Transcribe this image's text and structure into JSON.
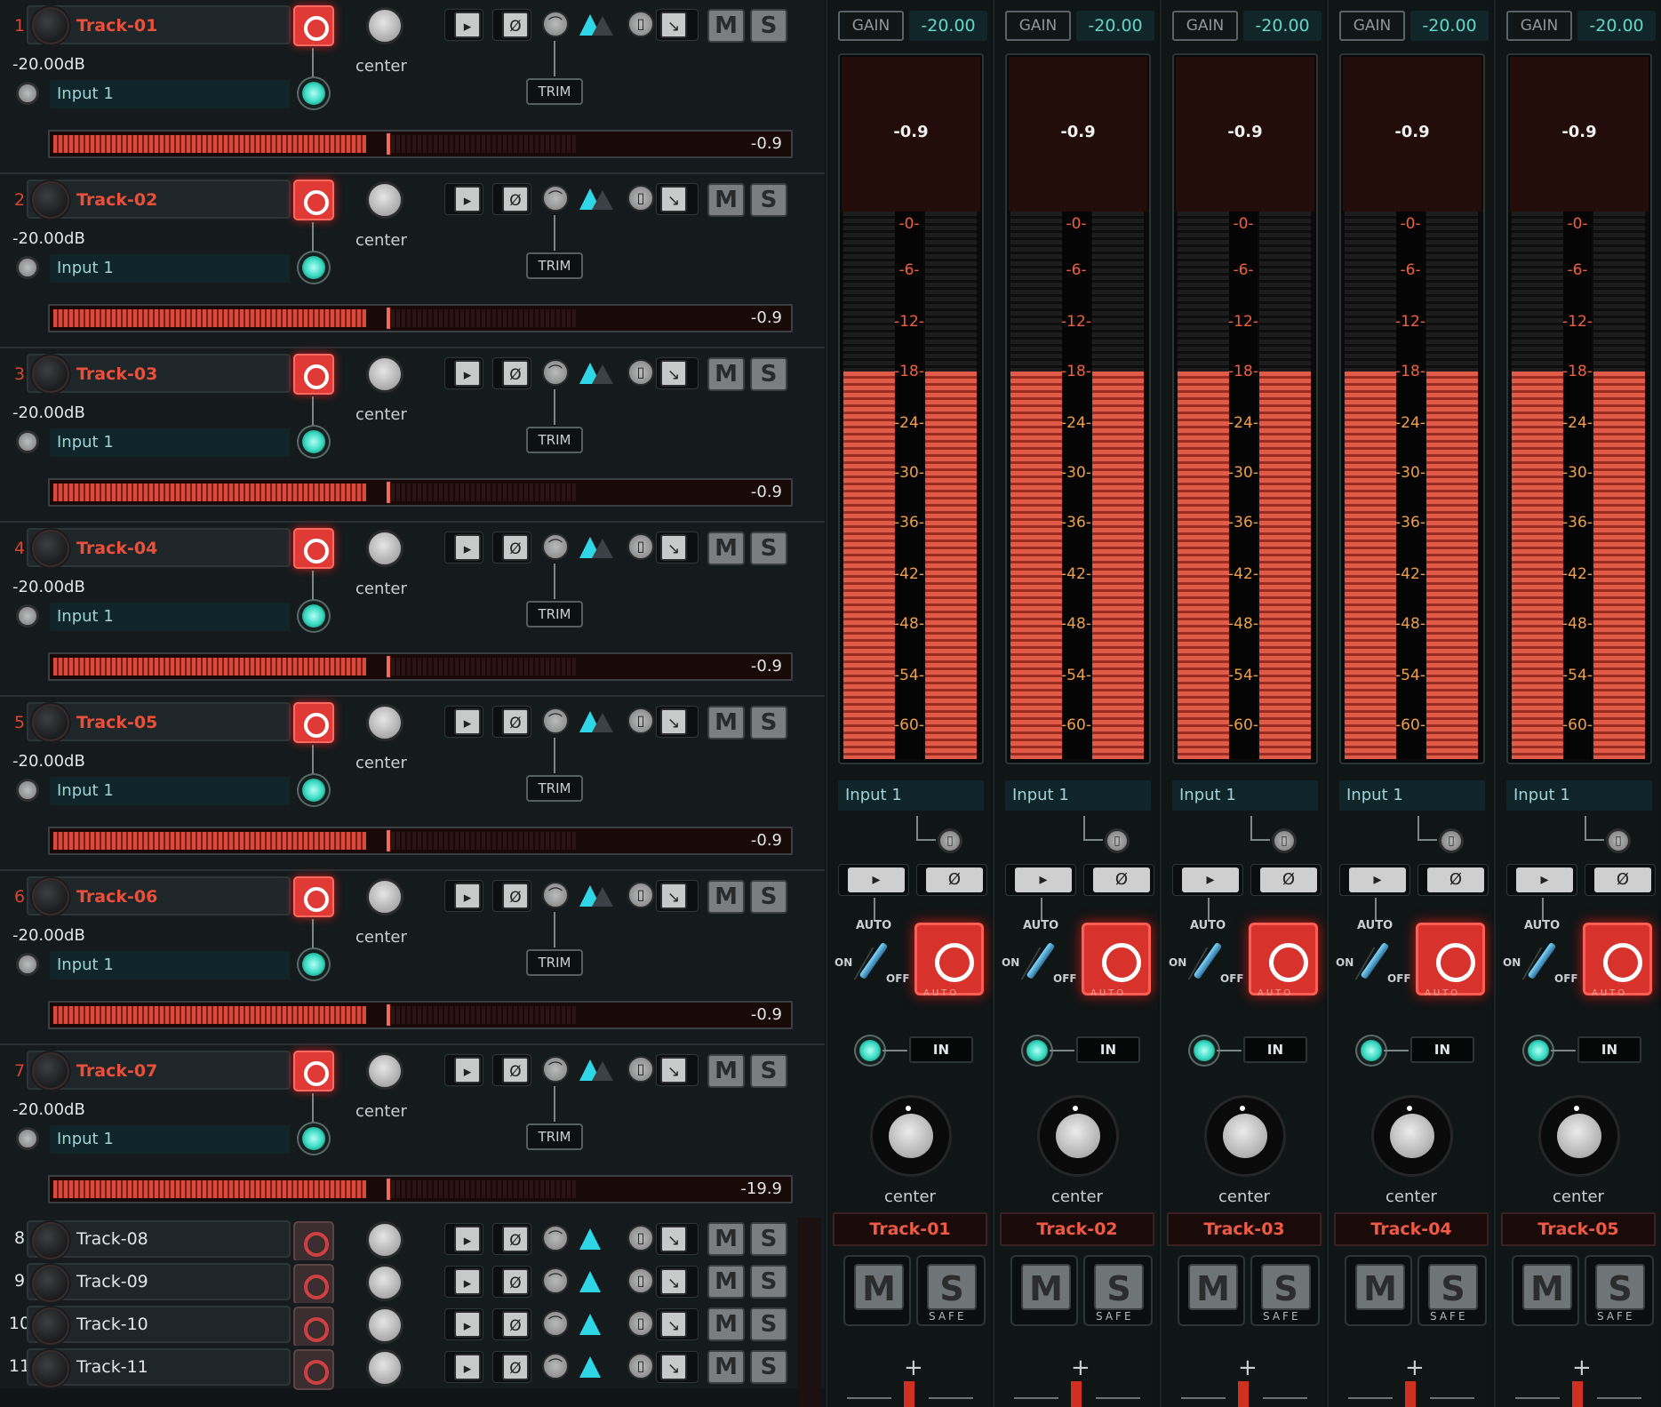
{
  "tracks": [
    {
      "num": "1",
      "name": "Track-01",
      "db": "-20.00dB",
      "input": "Input 1",
      "pan": "center",
      "trim": "TRIM",
      "meter": "-0.9",
      "level": 0.34
    },
    {
      "num": "2",
      "name": "Track-02",
      "db": "-20.00dB",
      "input": "Input 1",
      "pan": "center",
      "trim": "TRIM",
      "meter": "-0.9",
      "level": 0.34
    },
    {
      "num": "3",
      "name": "Track-03",
      "db": "-20.00dB",
      "input": "Input 1",
      "pan": "center",
      "trim": "TRIM",
      "meter": "-0.9",
      "level": 0.34
    },
    {
      "num": "4",
      "name": "Track-04",
      "db": "-20.00dB",
      "input": "Input 1",
      "pan": "center",
      "trim": "TRIM",
      "meter": "-0.9",
      "level": 0.34
    },
    {
      "num": "5",
      "name": "Track-05",
      "db": "-20.00dB",
      "input": "Input 1",
      "pan": "center",
      "trim": "TRIM",
      "meter": "-0.9",
      "level": 0.34
    },
    {
      "num": "6",
      "name": "Track-06",
      "db": "-20.00dB",
      "input": "Input 1",
      "pan": "center",
      "trim": "TRIM",
      "meter": "-0.9",
      "level": 0.34
    },
    {
      "num": "7",
      "name": "Track-07",
      "db": "-20.00dB",
      "input": "Input 1",
      "pan": "center",
      "trim": "TRIM",
      "meter": "-19.9",
      "level": 0.34
    }
  ],
  "compact_tracks": [
    {
      "num": "8",
      "name": "Track-08"
    },
    {
      "num": "9",
      "name": "Track-09"
    },
    {
      "num": "10",
      "name": "Track-10"
    },
    {
      "num": "11",
      "name": "Track-11"
    }
  ],
  "buttons": {
    "mute": "M",
    "solo": "S",
    "phase": "Ø"
  },
  "strips": [
    {
      "name": "Track-01",
      "gain_label": "GAIN",
      "gain": "-20.00",
      "peak": "-0.9",
      "input": "Input 1",
      "pan": "center"
    },
    {
      "name": "Track-02",
      "gain_label": "GAIN",
      "gain": "-20.00",
      "peak": "-0.9",
      "input": "Input 1",
      "pan": "center"
    },
    {
      "name": "Track-03",
      "gain_label": "GAIN",
      "gain": "-20.00",
      "peak": "-0.9",
      "input": "Input 1",
      "pan": "center"
    },
    {
      "name": "Track-04",
      "gain_label": "GAIN",
      "gain": "-20.00",
      "peak": "-0.9",
      "input": "Input 1",
      "pan": "center"
    },
    {
      "name": "Track-05",
      "gain_label": "GAIN",
      "gain": "-20.00",
      "peak": "-0.9",
      "input": "Input 1",
      "pan": "center"
    }
  ],
  "strip_labels": {
    "auto": "AUTO",
    "on": "ON",
    "off": "OFF",
    "auto_sub": "AUTO",
    "in": "IN",
    "safe": "SAFE",
    "plus": "+"
  },
  "meter_scale": [
    "-0-",
    "-6-",
    "-12-",
    "-18-",
    "-24-",
    "-30-",
    "-36-",
    "-42-",
    "-48-",
    "-54-",
    "-60-"
  ],
  "colors": {
    "record": "#e03a36",
    "meter": "#d94a3d",
    "accent": "#2ed6e6",
    "track_name": "#e8503a",
    "input_led": "#35d8c0"
  }
}
